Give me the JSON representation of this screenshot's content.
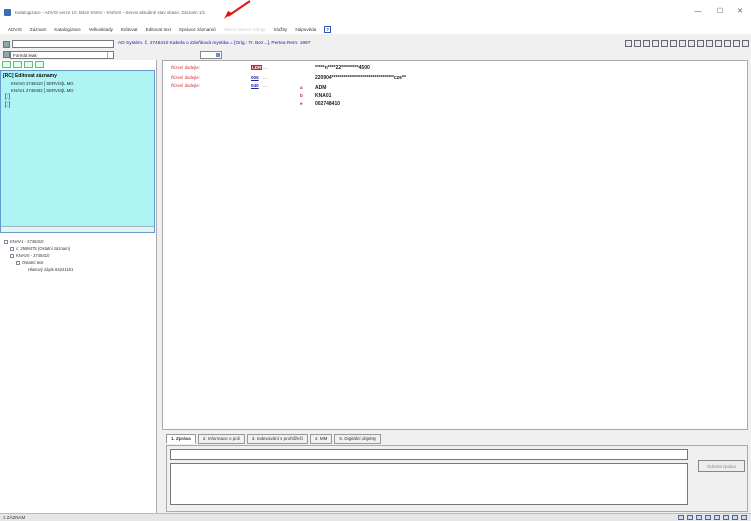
{
  "window": {
    "title": "Katalogizace - ADVIS verze 10. Báze KNAV - KNAVS - Servis aktuálně stav vbase: Záznam 1/1",
    "controls": [
      "—",
      "☐",
      "✕"
    ]
  },
  "menu": {
    "items": [
      "ADVIS",
      "Záznam",
      "Katalogizace",
      "Velkosklady",
      "Editovat",
      "Editovat text",
      "Správce záznamů",
      "Hlavní datové zdroje",
      "Služby",
      "Nápověda"
    ],
    "help_icon": "?"
  },
  "toolbar": {
    "format_label": "Formát leak",
    "record_title": "AD Systém. č. 2748410 Kabela o Zdeňková mystika = [Orig.: Tr. Bez...], Pertea Rem: 1997"
  },
  "left_panel": {
    "edit_list_title": "[RC] Editovat záznamy",
    "edit_items": [
      "KNAV0 2748410 [ SERVIS]L MO",
      "KNAV1 2748432 [ SERVIS]L MO"
    ],
    "brackets": [
      "[:]",
      "[:]"
    ],
    "tree": [
      {
        "label": "KNAV1 - 2748410",
        "indent": 0
      },
      {
        "label": "c: 2588475 (Ostatní záznam)",
        "indent": 1
      },
      {
        "label": "KNAV0 - 2748410",
        "indent": 1
      },
      {
        "label": "Ostatní text",
        "indent": 2
      },
      {
        "label": "Hlasový zápis 64241161",
        "indent": 3
      }
    ]
  },
  "editor": {
    "fields": [
      {
        "name": "Řízení dodejte:",
        "tag": "LDR",
        "dots": "....",
        "value": "*****n****22*********4500",
        "highlight": true
      },
      {
        "name": "Řízení dodejte:",
        "tag": "005",
        "dots": "....",
        "value": "220904********************************cze**",
        "highlight": false
      },
      {
        "name": "Řízení dodejte:",
        "tag": "040",
        "dots": "....",
        "value": "",
        "highlight": false
      }
    ],
    "subfields": [
      {
        "code": "a",
        "value": "ADM"
      },
      {
        "code": "b",
        "value": "KNA01"
      },
      {
        "code": "e",
        "value": "002748410"
      }
    ]
  },
  "bottom_tabs": [
    "1. Zpráva",
    "2. Informace o poli",
    "3. Indexování v prohlížeči",
    "4. MM",
    "5. Digitální objekty"
  ],
  "note": {
    "button_label": "Odeslat zprávu"
  },
  "statusbar": {
    "left_text": "1 ZÁZNAM",
    "icons": [
      "status-1",
      "status-2",
      "status-3",
      "status-4",
      "status-5",
      "status-6",
      "status-7",
      "status-8"
    ]
  },
  "colors": {
    "cyan_panel": "#aef4f4",
    "field_name_red": "#cc2a2a",
    "tag_blue": "#2222aa",
    "highlight_red": "#c8202c",
    "title_blue": "#1a1aa0"
  }
}
